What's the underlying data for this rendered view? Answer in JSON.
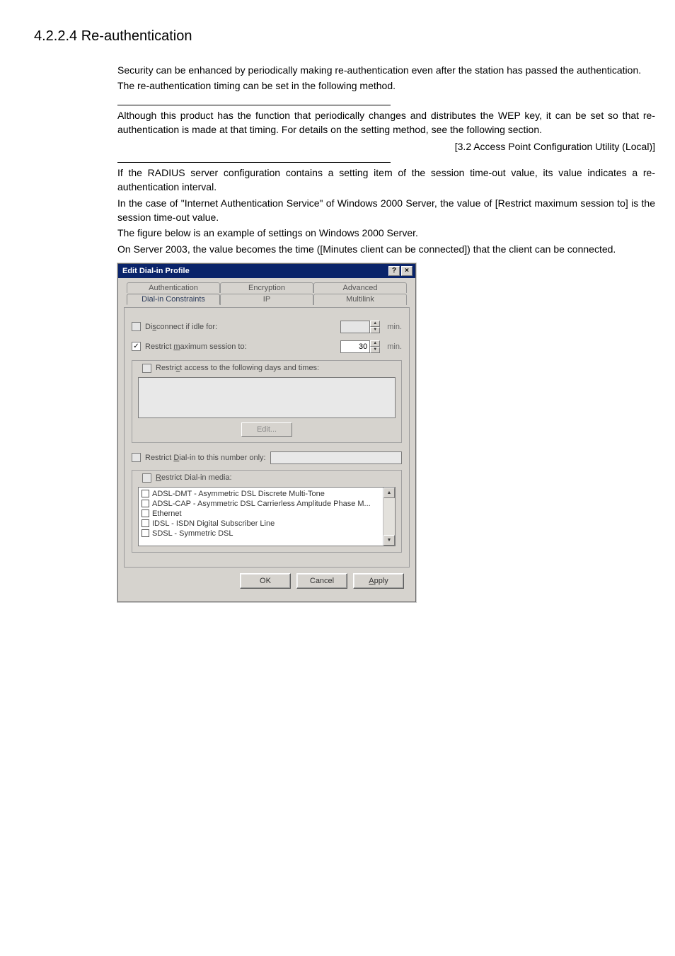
{
  "heading": "4.2.2.4 Re-authentication",
  "intro": {
    "p1": "Security can be enhanced by periodically making re-authentication even after the station has passed the authentication.",
    "p2": "The re-authentication timing can be set in the following method."
  },
  "note1": {
    "p1": "Although this product has the function that periodically changes and distributes the WEP key, it can be set so that re-authentication is made at that timing.  For details on the setting method, see the following section.",
    "ref": "[3.2  Access Point Configuration Utility (Local)]"
  },
  "note2": {
    "p1": "If the RADIUS server configuration contains a setting item of the session time-out value, its value indicates a re-authentication interval.",
    "p2": "In the case of \"Internet Authentication Service\" of Windows 2000 Server, the value of [Restrict maximum session to] is the session time-out value.",
    "p3": "The figure below is an example of settings on Windows 2000 Server.",
    "p4": "On Server 2003, the value becomes the time ([Minutes client can be connected]) that the client can be connected."
  },
  "dialog": {
    "title": "Edit Dial-in Profile",
    "help_btn": "?",
    "close_btn": "×",
    "tabs_top": {
      "t1": "Authentication",
      "t2": "Encryption",
      "t3": "Advanced"
    },
    "tabs_bot": {
      "t1": "Dial-in Constraints",
      "t2": "IP",
      "t3": "Multilink"
    },
    "disconnect": {
      "label": "Disconnect if idle for:",
      "value": "",
      "unit": "min."
    },
    "restrict_max": {
      "label": "Restrict maximum session to:",
      "value": "30",
      "unit": "min."
    },
    "restrict_days": {
      "label": "Restrict access to the following days and times:",
      "edit_btn": "Edit..."
    },
    "dialin_number": {
      "label": "Restrict Dial-in to this number only:",
      "value": ""
    },
    "restrict_media": {
      "label": "Restrict Dial-in media:",
      "items": [
        "ADSL-DMT - Asymmetric DSL Discrete Multi-Tone",
        "ADSL-CAP - Asymmetric DSL Carrierless Amplitude Phase M...",
        "Ethernet",
        "IDSL - ISDN Digital Subscriber Line",
        "SDSL - Symmetric DSL"
      ]
    },
    "buttons": {
      "ok": "OK",
      "cancel": "Cancel",
      "apply": "Apply"
    }
  }
}
